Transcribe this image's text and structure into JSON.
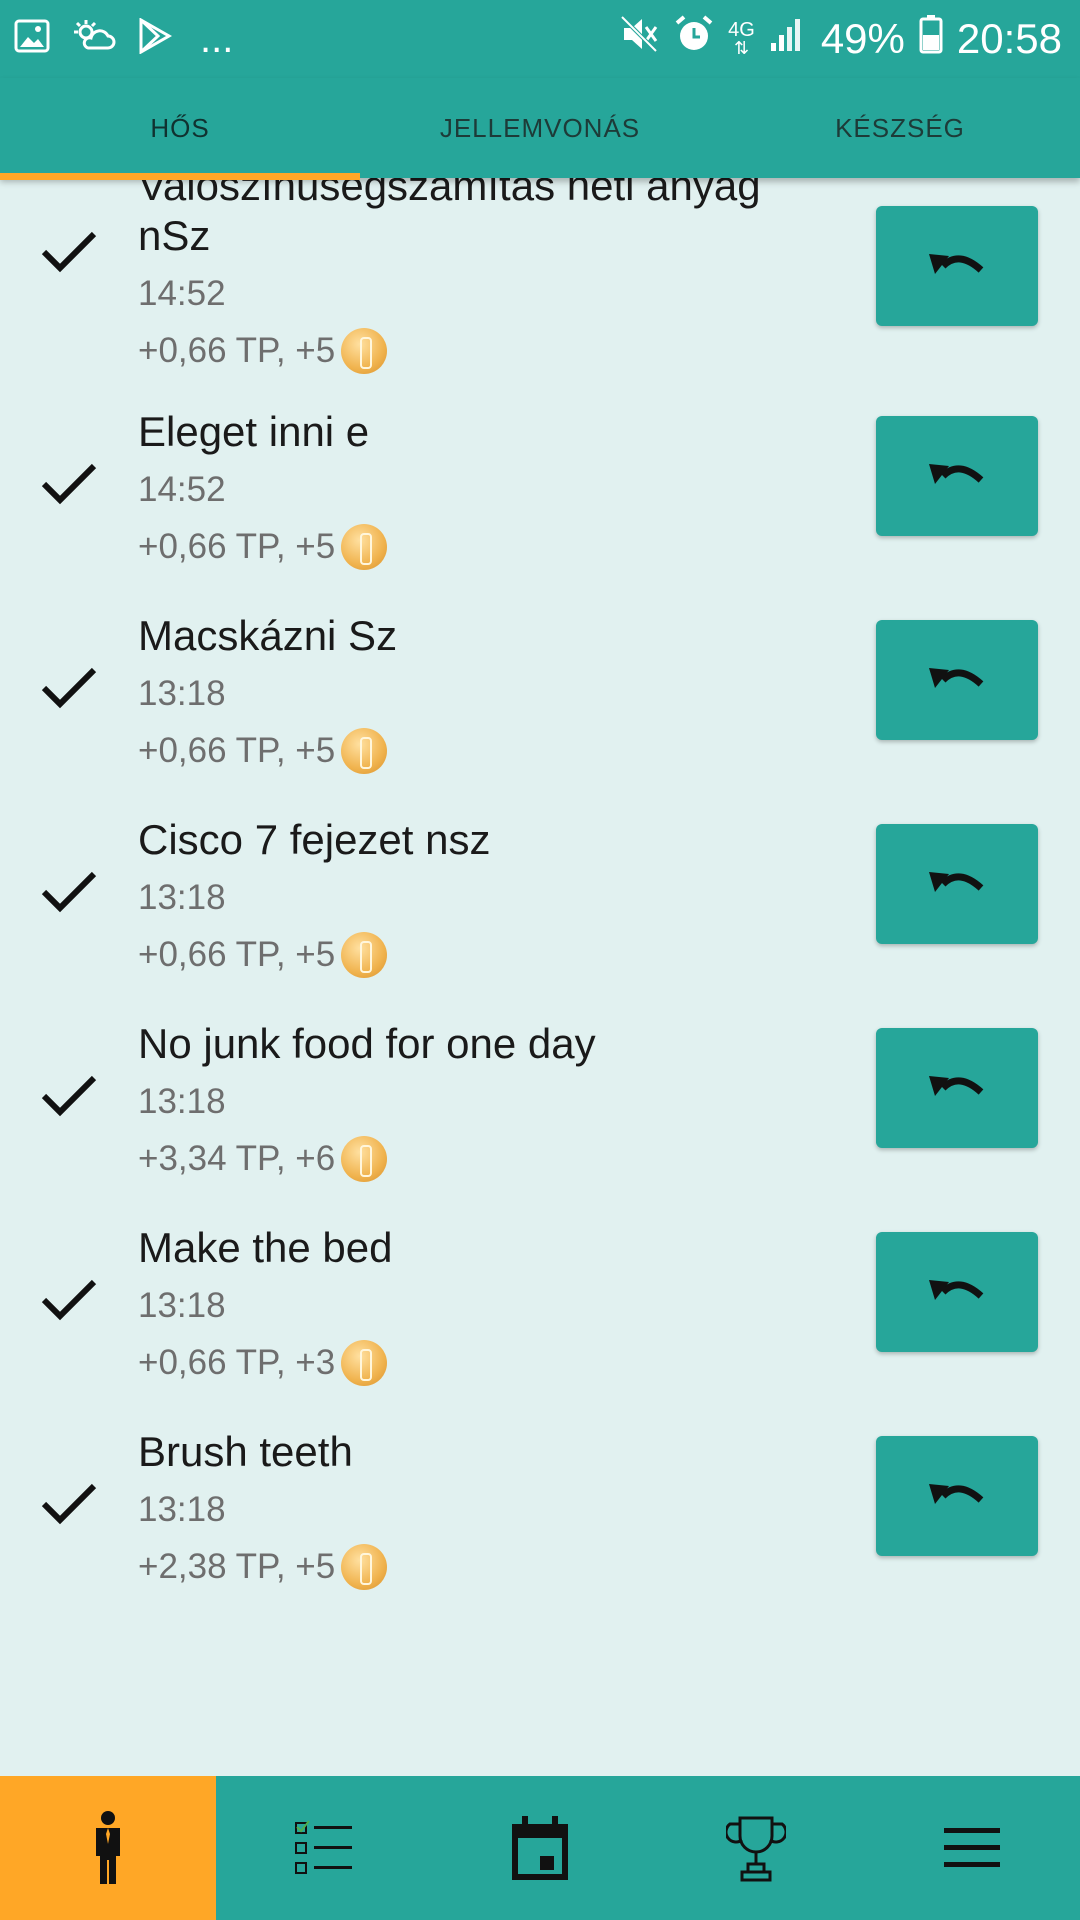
{
  "status_bar": {
    "battery_percent": "49%",
    "time": "20:58",
    "network": "4G",
    "more": "...",
    "icons_left": [
      "image-icon",
      "weather-icon",
      "play-store-icon"
    ],
    "icons_right": [
      "mute-icon",
      "alarm-icon",
      "network-4g-icon",
      "signal-icon",
      "battery-icon"
    ]
  },
  "tabs": [
    {
      "label": "HŐS",
      "active": true
    },
    {
      "label": "JELLEMVONÁS",
      "active": false
    },
    {
      "label": "KÉSZSÉG",
      "active": false
    }
  ],
  "colors": {
    "primary": "#26a69a",
    "accent": "#ffa726",
    "background": "#e1f1f0"
  },
  "items": [
    {
      "title_line1": "Valószínűségszámítás heti anyag",
      "title_line2": "nSz",
      "time": "14:52",
      "reward": "+0,66 TP, +5"
    },
    {
      "title": "Eleget inni e",
      "time": "14:52",
      "reward": "+0,66 TP, +5"
    },
    {
      "title": "Macskázni Sz",
      "time": "13:18",
      "reward": "+0,66 TP, +5"
    },
    {
      "title": "Cisco 7 fejezet nsz",
      "time": "13:18",
      "reward": "+0,66 TP, +5"
    },
    {
      "title": "No junk food for one day",
      "time": "13:18",
      "reward": "+3,34 TP, +6"
    },
    {
      "title": "Make the bed",
      "time": "13:18",
      "reward": "+0,66 TP, +3"
    },
    {
      "title": "Brush teeth",
      "time": "13:18",
      "reward": "+2,38 TP, +5"
    }
  ],
  "bottom_nav": [
    {
      "icon": "hero-icon",
      "active": true
    },
    {
      "icon": "checklist-icon",
      "active": false
    },
    {
      "icon": "calendar-icon",
      "active": false
    },
    {
      "icon": "trophy-icon",
      "active": false
    },
    {
      "icon": "menu-icon",
      "active": false
    }
  ]
}
